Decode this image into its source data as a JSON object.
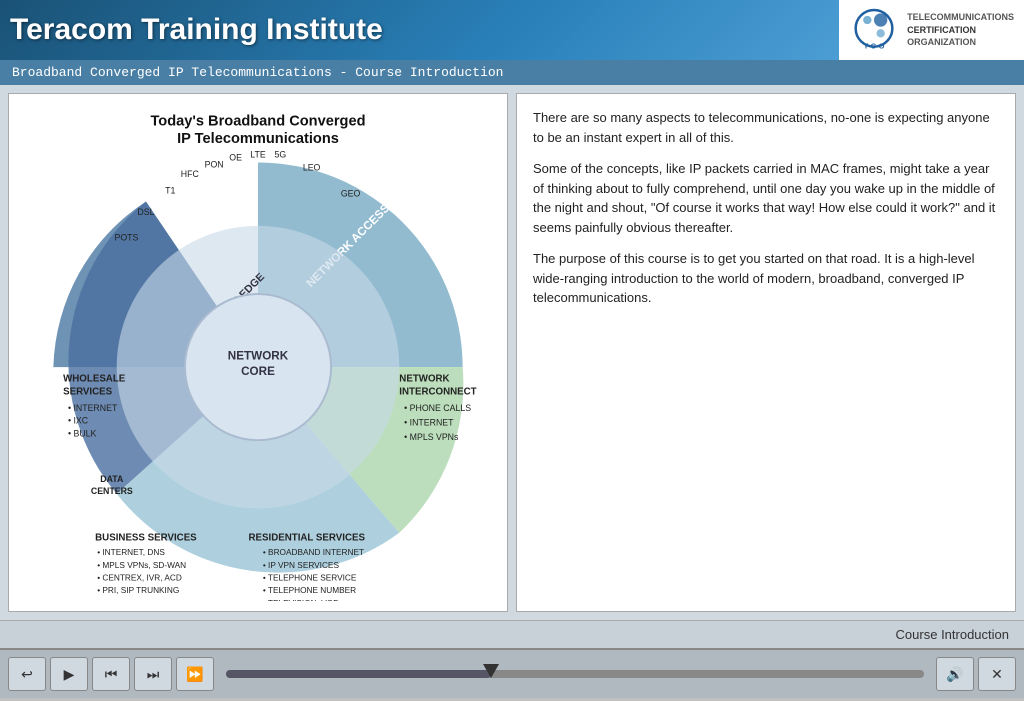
{
  "header": {
    "title": "Teracom Training Institute",
    "logo_line1": "TELECOMMUNICATIONS",
    "logo_line2": "CERTIFICATION",
    "logo_line3": "ORGANIZATION"
  },
  "subtitle": "Broadband Converged IP Telecommunications - Course Introduction",
  "diagram": {
    "title_line1": "Today's Broadband Converged",
    "title_line2": "IP Telecommunications"
  },
  "right_panel": {
    "para1": "There are so many aspects to telecommunications, no-one is expecting anyone to be an instant expert in all of this.",
    "para2": "Some of the concepts, like IP packets carried in MAC frames, might take a year of thinking about to fully comprehend, until one day you wake up in the middle of the night and shout, \"Of course it works that way!  How else could it work?\" and it seems painfully obvious thereafter.",
    "para3": "The purpose of this course is to get you started on that road.  It is a high-level wide-ranging introduction to the world of modern, broadband, converged IP telecommunications."
  },
  "footer": {
    "label": "Course Introduction"
  },
  "controls": {
    "back_icon": "↩",
    "play_icon": "▶",
    "prev_chapter_icon": "⏮",
    "next_chapter_icon": "⏭",
    "fast_forward_icon": "⏩",
    "volume_icon": "🔊",
    "close_icon": "✕"
  }
}
